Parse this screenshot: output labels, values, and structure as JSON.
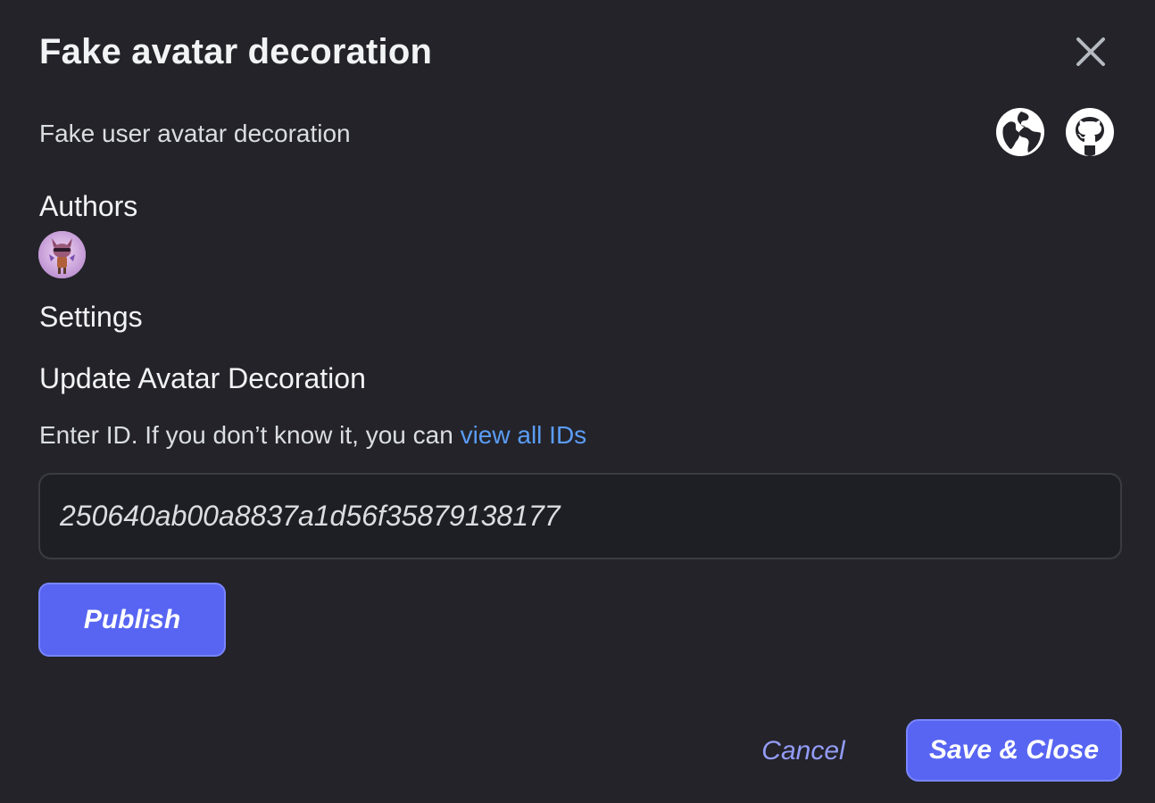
{
  "modal": {
    "title": "Fake avatar decoration",
    "description": "Fake user avatar decoration",
    "close_icon": "close-icon",
    "links": [
      {
        "icon": "globe-icon"
      },
      {
        "icon": "github-icon"
      }
    ]
  },
  "authors": {
    "heading": "Authors",
    "avatars": [
      {
        "icon": "author-avatar"
      }
    ]
  },
  "settings": {
    "heading": "Settings",
    "field_title": "Update Avatar Decoration",
    "hint_prefix": "Enter ID. If you don’t know it, you can ",
    "hint_link": "view all IDs",
    "input_value": "250640ab00a8837a1d56f35879138177",
    "publish_label": "Publish"
  },
  "footer": {
    "cancel_label": "Cancel",
    "save_label": "Save & Close"
  },
  "colors": {
    "background": "#232329",
    "accent": "#5865f2",
    "link": "#5b9cf6",
    "cancel_text": "#949cf7"
  }
}
